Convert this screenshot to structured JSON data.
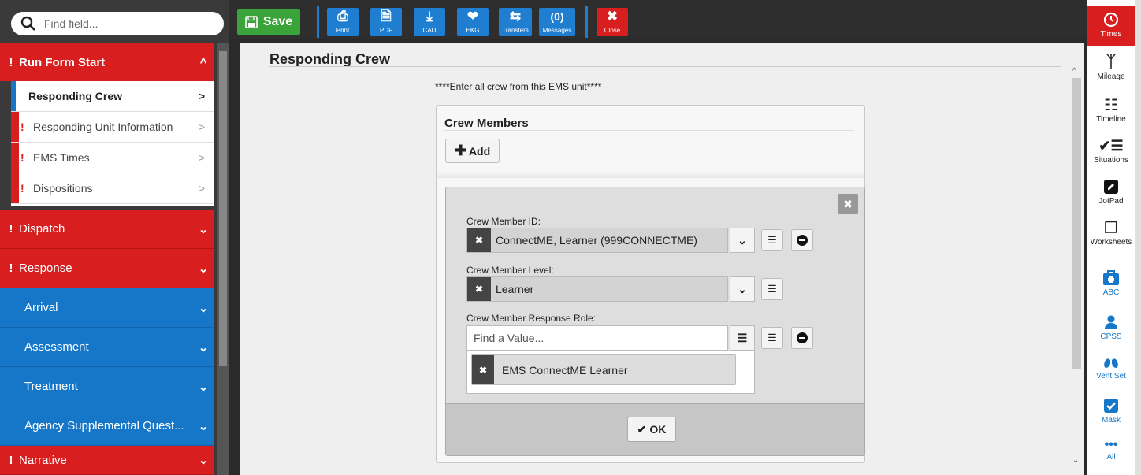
{
  "search": {
    "placeholder": "Find field..."
  },
  "sidebar": {
    "run_form": {
      "label": "Run Form Start",
      "alert": "!"
    },
    "sub_items": [
      {
        "label": "Responding Crew"
      },
      {
        "label": "Responding Unit Information",
        "alert": "!"
      },
      {
        "label": "EMS Times",
        "alert": "!"
      },
      {
        "label": "Dispositions",
        "alert": "!"
      }
    ],
    "sections": [
      {
        "label": "Dispatch",
        "alert": "!",
        "color": "#d81e1e"
      },
      {
        "label": "Response",
        "alert": "!",
        "color": "#d81e1e"
      },
      {
        "label": "Arrival",
        "color": "#1677c9"
      },
      {
        "label": "Assessment",
        "color": "#1677c9"
      },
      {
        "label": "Treatment",
        "color": "#1677c9"
      },
      {
        "label": "Agency Supplemental Quest...",
        "color": "#1677c9"
      },
      {
        "label": "Narrative",
        "alert": "!",
        "color": "#d81e1e"
      }
    ]
  },
  "toolbar": {
    "save_label": "Save",
    "buttons": [
      {
        "label": "Print",
        "icon": "printer-icon"
      },
      {
        "label": "PDF",
        "icon": "pdf-icon"
      },
      {
        "label": "CAD",
        "icon": "download-icon"
      },
      {
        "label": "EKG",
        "icon": "heart-pulse-icon"
      },
      {
        "label": "Transfers",
        "icon": "transfer-icon"
      },
      {
        "label": "Messages",
        "icon": "messages-icon",
        "count": "(0)"
      }
    ],
    "close_label": "Close"
  },
  "main": {
    "title": "Responding Crew",
    "instructions": "****Enter all crew from this EMS unit****",
    "crew_panel": {
      "heading": "Crew Members",
      "add_label": "Add",
      "member": {
        "id_label": "Crew Member ID:",
        "id_value": "ConnectME, Learner (999CONNECTME)",
        "level_label": "Crew Member Level:",
        "level_value": "Learner",
        "role_label": "Crew Member Response Role:",
        "role_placeholder": "Find a Value...",
        "role_selected": "EMS ConnectME Learner",
        "ok_label": "OK"
      }
    }
  },
  "rightbar": [
    {
      "label": "Times",
      "icon": "clock-icon",
      "alert": "!"
    },
    {
      "label": "Mileage",
      "icon": "road-icon"
    },
    {
      "label": "Timeline",
      "icon": "sliders-icon"
    },
    {
      "label": "Situations",
      "icon": "check-list-icon"
    },
    {
      "label": "JotPad",
      "icon": "pencil-icon"
    },
    {
      "label": "Worksheets",
      "icon": "copy-icon"
    },
    {
      "label": "ABC",
      "icon": "medkit-icon"
    },
    {
      "label": "CPSS",
      "icon": "user-icon"
    },
    {
      "label": "Vent Set",
      "icon": "lungs-icon"
    },
    {
      "label": "Mask",
      "icon": "checkbox-icon"
    },
    {
      "label": "All",
      "icon": "ellipsis-icon"
    }
  ],
  "colors": {
    "alert_red": "#d81e1e",
    "nav_blue": "#1677c9",
    "save_green": "#3aa33a"
  }
}
